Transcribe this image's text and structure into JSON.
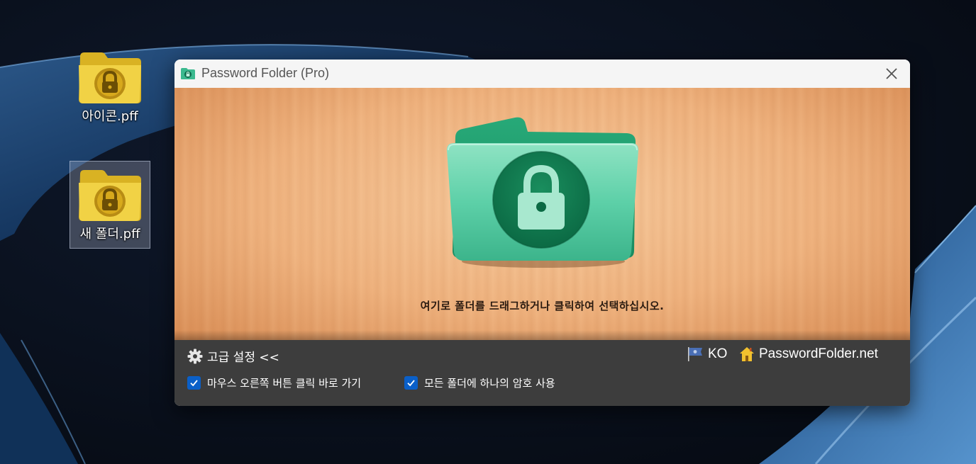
{
  "desktop": {
    "icons": [
      {
        "label": "아이콘.pff",
        "icon": "locked-folder-icon"
      },
      {
        "label": "새 폴더.pff",
        "icon": "locked-folder-icon"
      }
    ]
  },
  "window": {
    "title": "Password Folder (Pro)",
    "close_icon": "close-icon",
    "drop_text": "여기로 폴더를 드래그하거나 클릭하여 선택하십시오.",
    "big_icon": "green-locked-folder-icon"
  },
  "bottom": {
    "advanced_label": "고급 설정 <<",
    "language": "KO",
    "website": "PasswordFolder.net",
    "options": [
      {
        "label": "마우스 오른쪽 버튼 클릭 바로 가기",
        "checked": true
      },
      {
        "label": "모든 폴더에 하나의 암호 사용",
        "checked": true
      }
    ]
  },
  "colors": {
    "window_bottom": "#3d3d3d",
    "checkbox": "#0a5fc8",
    "wood": "#efb27e",
    "folder_green": "#3cc29a"
  }
}
